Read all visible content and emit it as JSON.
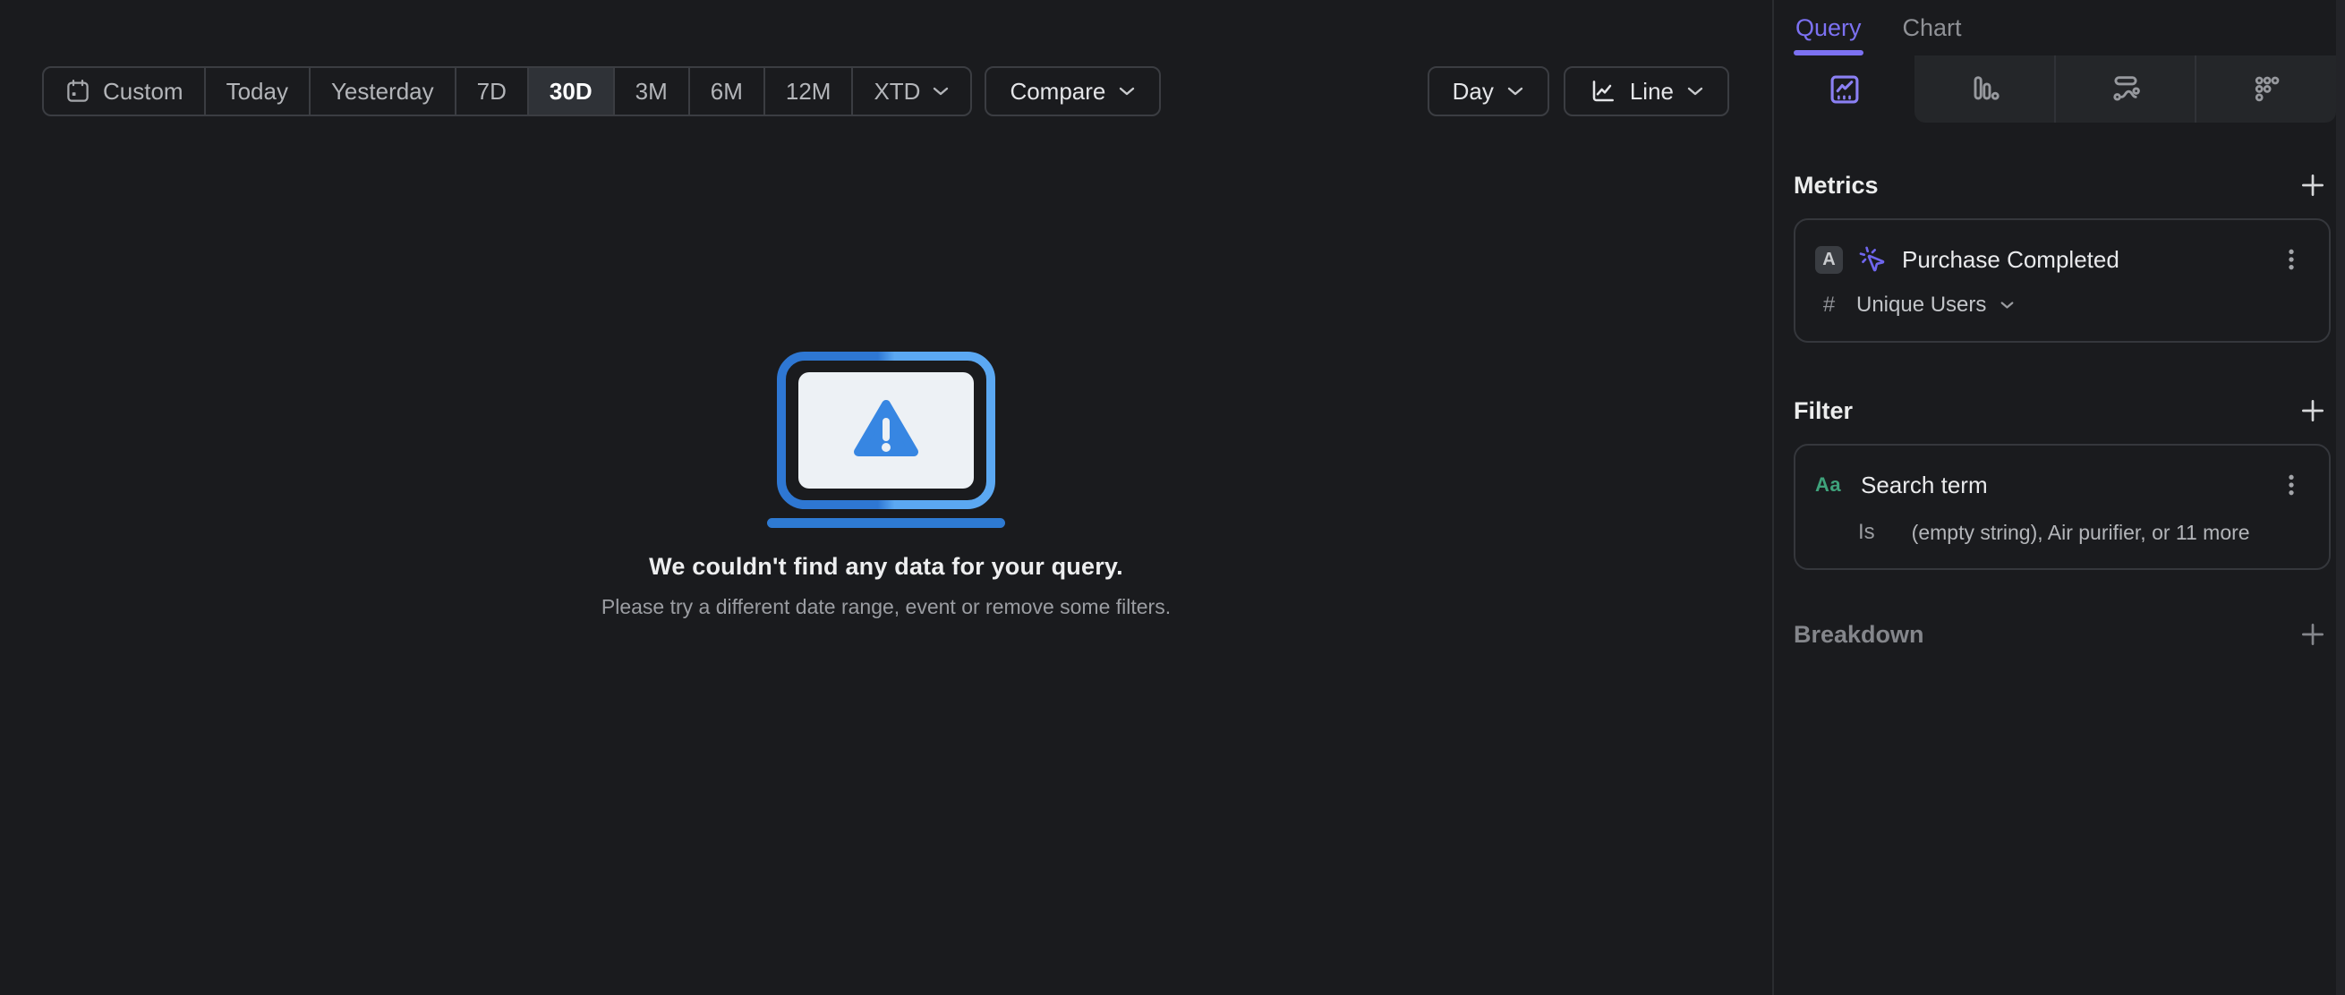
{
  "toolbar": {
    "date_ranges": [
      "Custom",
      "Today",
      "Yesterday",
      "7D",
      "30D",
      "3M",
      "6M",
      "12M",
      "XTD"
    ],
    "selected_range": "30D",
    "compare_label": "Compare",
    "granularity_label": "Day",
    "chart_type_label": "Line"
  },
  "empty_state": {
    "title": "We couldn't find any data for your query.",
    "subtitle": "Please try a different date range, event or remove some filters."
  },
  "sidebar": {
    "tabs": {
      "query": "Query",
      "chart": "Chart"
    },
    "view_tabs": [
      "insights",
      "funnels",
      "flows",
      "retention"
    ],
    "metrics": {
      "header": "Metrics",
      "item": {
        "letter": "A",
        "event": "Purchase Completed",
        "aggregation_symbol": "#",
        "aggregation": "Unique Users"
      }
    },
    "filter": {
      "header": "Filter",
      "item": {
        "type_label": "Aa",
        "property": "Search term",
        "operator": "Is",
        "values": "(empty string), Air purifier, or 11 more"
      }
    },
    "breakdown": {
      "header": "Breakdown"
    }
  },
  "colors": {
    "accent_purple": "#7c71f2",
    "property_green": "#3fa27b",
    "illustration_blue": "#3786e2",
    "selected_segment_bg": "#2f3237",
    "background": "#1a1b1e"
  }
}
